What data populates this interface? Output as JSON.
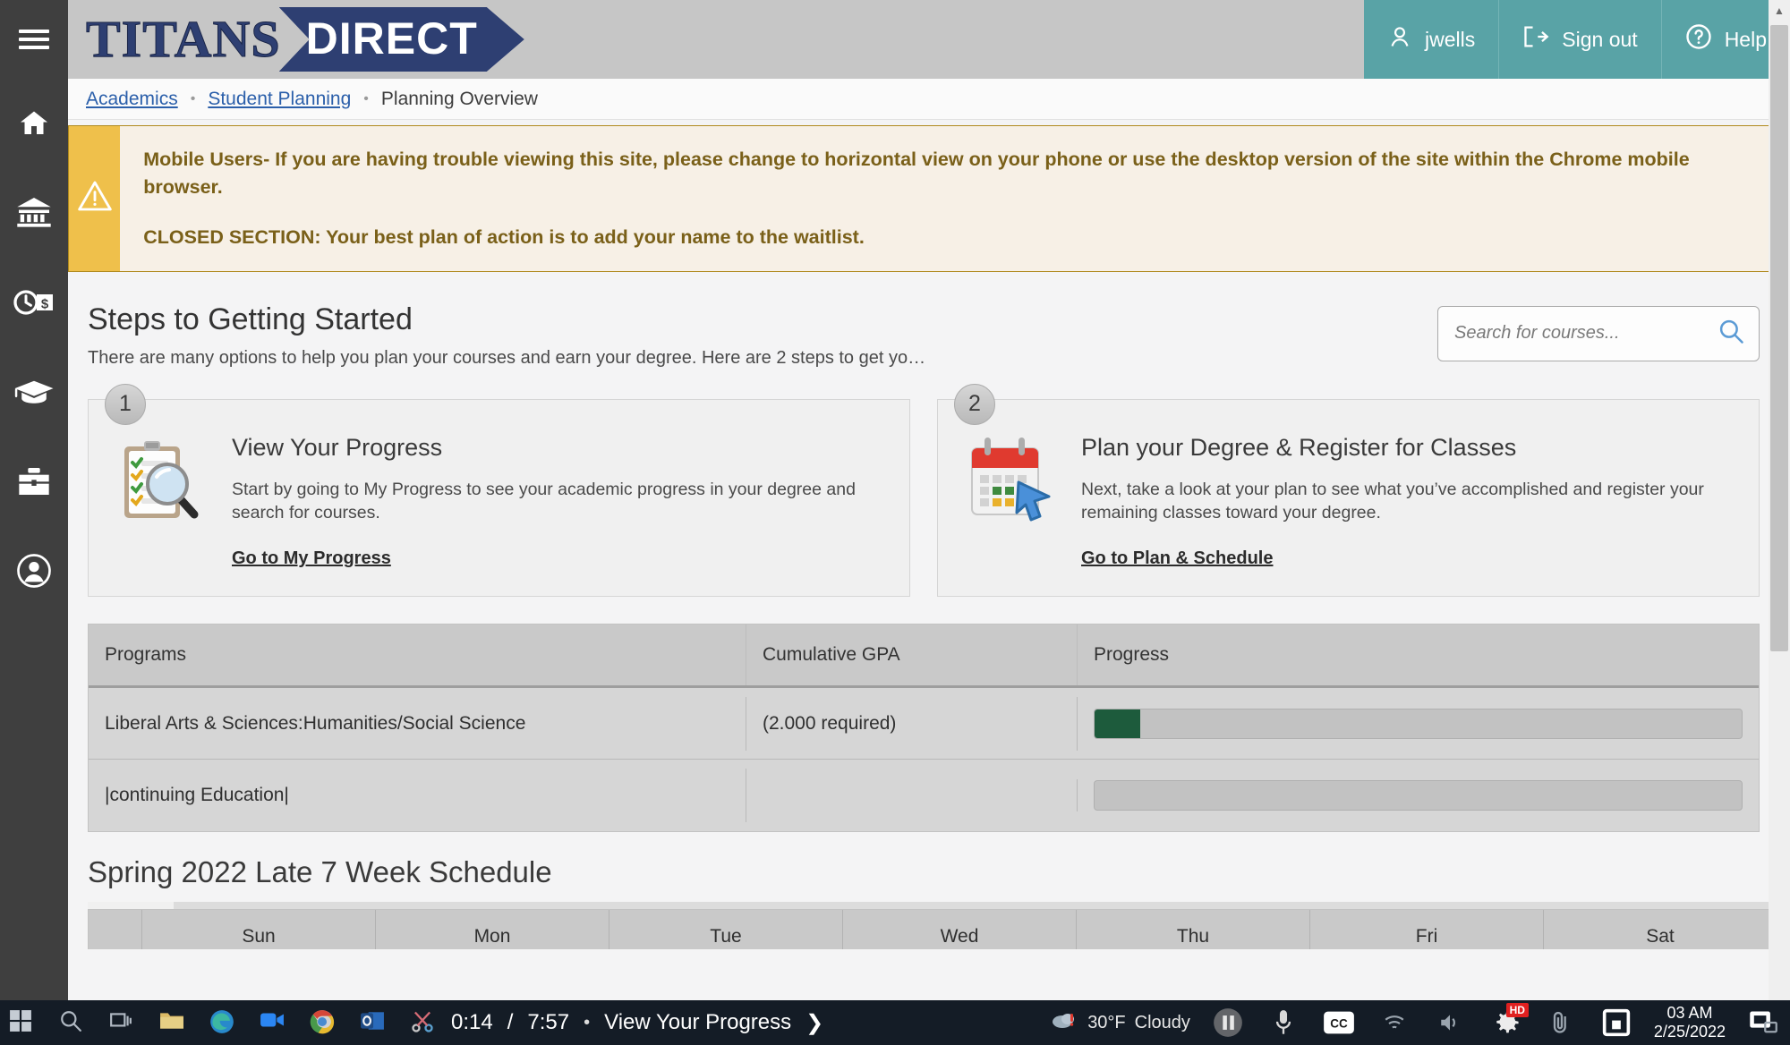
{
  "brand": {
    "titans": "TITANS",
    "direct": "DIRECT"
  },
  "rail": {
    "menu_label": "Menu",
    "items": [
      {
        "name": "home",
        "label": "Home"
      },
      {
        "name": "financial-institution",
        "label": "Financial Information"
      },
      {
        "name": "time-money",
        "label": "Time Entry"
      },
      {
        "name": "graduation-cap",
        "label": "Academics"
      },
      {
        "name": "briefcase",
        "label": "Employment"
      },
      {
        "name": "user-circle",
        "label": "User Profile"
      }
    ]
  },
  "topbar": {
    "user": "jwells",
    "sign_out": "Sign out",
    "help": "Help"
  },
  "breadcrumb": {
    "items": [
      {
        "label": "Academics",
        "link": true
      },
      {
        "label": "Student Planning",
        "link": true
      },
      {
        "label": "Planning Overview",
        "link": false
      }
    ],
    "separator": "•"
  },
  "alert": {
    "line1": "Mobile Users- If you are having trouble viewing this site, please change to horizontal view on your phone or use the desktop version of the site within the Chrome mobile browser.",
    "line2": "CLOSED SECTION: Your best plan of action is to add your name to the waitlist.",
    "icon": "warning-triangle-icon"
  },
  "steps": {
    "title": "Steps to Getting Started",
    "subtitle": "There are many options to help you plan your courses and earn your degree. Here are 2 steps to get yo…"
  },
  "search": {
    "value": "",
    "placeholder": "Search for courses...",
    "icon": "search-icon"
  },
  "cards": [
    {
      "badge": "1",
      "icon": "clipboard-magnifier-icon",
      "title": "View Your Progress",
      "desc": "Start by going to My Progress to see your academic progress in your degree and search for courses.",
      "link": "Go to My Progress"
    },
    {
      "badge": "2",
      "icon": "calendar-cursor-icon",
      "title": "Plan your Degree & Register for Classes",
      "desc": "Next, take a look at your plan to see what you’ve accomplished and register your remaining classes toward your degree.",
      "link": "Go to Plan & Schedule"
    }
  ],
  "programs_table": {
    "headers": [
      "Programs",
      "Cumulative GPA",
      "Progress"
    ],
    "rows": [
      {
        "program": "Liberal Arts & Sciences:Humanities/Social Science",
        "gpa": "(2.000 required)",
        "progress_percent": 7
      },
      {
        "program": "|continuing Education|",
        "gpa": "",
        "progress_percent": 0
      }
    ],
    "progress_fill_color": "#1d5b3c"
  },
  "schedule": {
    "title": "Spring 2022 Late 7 Week Schedule",
    "days": [
      "Sun",
      "Mon",
      "Tue",
      "Wed",
      "Thu",
      "Fri",
      "Sat"
    ]
  },
  "video_overlay": {
    "current_time": "0:14",
    "duration": "7:57",
    "separator": "/",
    "dot": "•",
    "chapter_title": "View Your Progress",
    "next_chevron": "❯",
    "controls": [
      {
        "name": "pause-button",
        "label": "Pause"
      },
      {
        "name": "microphone-icon",
        "label": "Microphone"
      },
      {
        "name": "closed-captions-button",
        "label": "CC"
      },
      {
        "name": "settings-gear-button",
        "label": "Settings",
        "badge": "HD"
      },
      {
        "name": "fullscreen-button",
        "label": "Fullscreen"
      },
      {
        "name": "picture-in-picture-button",
        "label": "Picture in picture"
      }
    ]
  },
  "taskbar": {
    "weather_temp": "30°F",
    "weather_cond": "Cloudy",
    "clock_time": "03 AM",
    "clock_date": "2/25/2022",
    "apps": [
      "start-windows-icon",
      "search-icon",
      "task-view-icon",
      "file-explorer-icon",
      "edge-icon",
      "zoom-icon",
      "chrome-icon",
      "outlook-icon",
      "snipping-tool-icon"
    ]
  },
  "scrollbar": {
    "up_arrow": "▲",
    "down_arrow": "▼"
  }
}
